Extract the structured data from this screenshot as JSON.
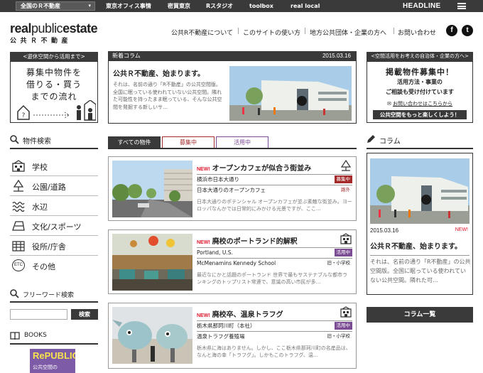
{
  "topbar": {
    "selector_label": "全国のＲ不動産",
    "links": [
      "東京オフィス事情",
      "密買東京",
      "Rスタジオ",
      "toolbox",
      "real local"
    ],
    "headline": "HEADLINE"
  },
  "logo": {
    "bold_a": "real",
    "light": "public",
    "bold_b": "estate",
    "sub": "公共Ｒ不動産"
  },
  "header_nav": [
    "公共R不動産について",
    "このサイトの使い方",
    "地方公共団体・企業の方へ",
    "お問い合わせ"
  ],
  "social": {
    "facebook": "f",
    "twitter": "t"
  },
  "promo_left": {
    "header": "<遊休空間から活用まで>",
    "line1": "募集中物件を",
    "line2": "借りる・買う",
    "line3": "までの流れ"
  },
  "new_column": {
    "header": "新着コラム",
    "date": "2015.03.16",
    "title": "公共Ｒ不動産、始まります。",
    "excerpt": "それは、名前の通り「R不動産」の公共空間版。全国に眠っている使われていない公共空間。隣れた可能性を持ったまま眠っている、そんな公共空間を発掘する新しいサ…"
  },
  "promo_right": {
    "header": "<空間活用をお考えの自治体・企業の方へ>",
    "title": "掲載物件募集中！",
    "line1": "活用方法・事業の",
    "line2": "ご相談も受け付けています",
    "contact": "お問い合わせはこちらから",
    "cta": "公共空間をもっと楽しくしよう！"
  },
  "sidebar": {
    "search_title": "物件検索",
    "categories": [
      "学校",
      "公園/道路",
      "水辺",
      "文化/スポーツ",
      "役所/庁舎",
      "その他"
    ],
    "etc_icon_text": "ETC",
    "freeword_title": "フリーワード検索",
    "search_placeholder": "",
    "search_button": "検索",
    "books_title": "BOOKS",
    "book_cover_title": "RePUBLIC",
    "book_cover_sub": "公共空間の"
  },
  "tabs": [
    "すべての物件",
    "募集中",
    "活用中"
  ],
  "listings": [
    {
      "new": "NEW!",
      "title": "オープンカフェが似合う街並み",
      "location": "横浜市日本大通り",
      "status": "募集中",
      "name": "日本大通りのオープンカフェ",
      "type": "路外",
      "desc": "日本大通りのポテンシャル オープンカフェが並ぶ素敵な街並み。ヨーロッパなんかでは日常的にみかける光景ですが、ここ…"
    },
    {
      "new": "NEW!",
      "title": "廃校のポートランド的解釈",
      "location": "Portland, U.S.",
      "status": "活用中",
      "name": "McMenamins Kennedy School",
      "type": "旧・小学校",
      "desc": "最近なにかと話題のポートランド 世界で最もサステナブルな都市ランキングのトップリスト常連で、意識の高い市民が多…"
    },
    {
      "new": "NEW!",
      "title": "廃校卒、温泉トラフグ",
      "location": "栃木県那珂川町（本社）",
      "status": "活用中",
      "name": "温泉トラフグ養殖場",
      "type": "旧・小学校",
      "desc": "栃木県に海はありません。しかし、ここ栃木県那珂川町の名産品は、なんと海の幸「トラフグ」。しかもこのトラフグ、温…"
    }
  ],
  "right_column": {
    "title": "コラム",
    "date": "2015.03.16",
    "new": "NEW!",
    "post_title": "公共Ｒ不動産、始まります。",
    "excerpt": "それは、名前の通り「R不動産」の公共空間版。全国に眠っている使われていない公共空間。隣れた可…",
    "all_button": "コラム一覧"
  },
  "colors": {
    "dark": "#3a3a3a",
    "recruit": "#a52a2a",
    "active": "#7b4b94",
    "new": "#e0162b"
  }
}
